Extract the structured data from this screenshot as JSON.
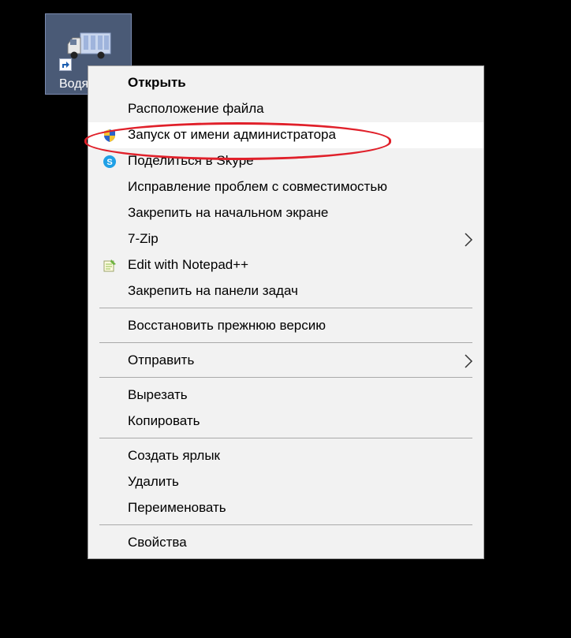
{
  "desktop": {
    "icon_label": "Водя",
    "colors": {
      "background": "#000000",
      "icon_selection": "#4a5a76"
    }
  },
  "context_menu": {
    "colors": {
      "background": "#f2f2f2",
      "hover": "#ffffff",
      "separator": "#a9a9a9",
      "callout": "#e0202a"
    },
    "items": [
      {
        "label": "Открыть"
      },
      {
        "label": "Расположение файла"
      },
      {
        "label": "Запуск от имени администратора",
        "icon": "uac-shield-icon",
        "highlighted": true
      },
      {
        "label": "Поделиться в Skype",
        "icon": "skype-icon"
      },
      {
        "label": "Исправление проблем с совместимостью"
      },
      {
        "label": "Закрепить на начальном экране"
      },
      {
        "label": "7-Zip",
        "submenu": true
      },
      {
        "label": "Edit with Notepad++",
        "icon": "notepad-plus-plus-icon"
      },
      {
        "label": "Закрепить на панели задач"
      },
      {
        "label": "Восстановить прежнюю версию"
      },
      {
        "label": "Отправить",
        "submenu": true
      },
      {
        "label": "Вырезать"
      },
      {
        "label": "Копировать"
      },
      {
        "label": "Создать ярлык"
      },
      {
        "label": "Удалить"
      },
      {
        "label": "Переименовать"
      },
      {
        "label": "Свойства"
      }
    ]
  }
}
